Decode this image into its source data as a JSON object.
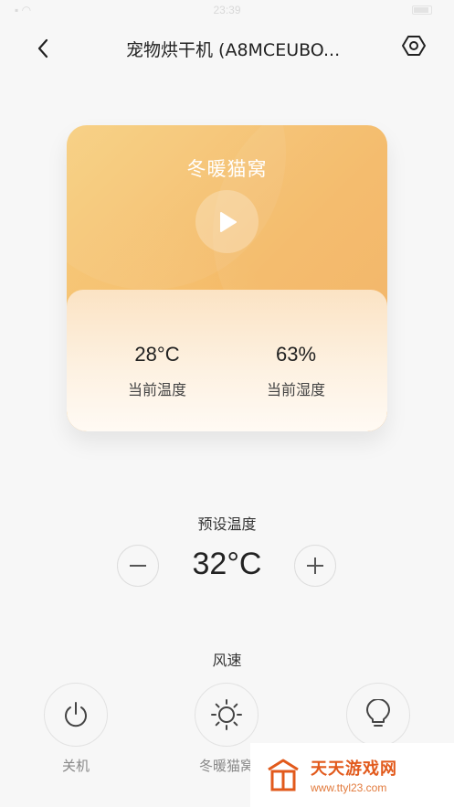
{
  "status_bar": {
    "time": "23:39"
  },
  "header": {
    "title": "宠物烘干机 (A8MCEUBO...",
    "back_icon": "chevron-left-icon",
    "settings_icon": "hexagon-gear-icon"
  },
  "card": {
    "mode_name": "冬暖猫窝",
    "play_icon": "play-icon",
    "current_temp": {
      "value": "28°C",
      "label": "当前温度"
    },
    "current_humidity": {
      "value": "63%",
      "label": "当前湿度"
    },
    "colors": {
      "gradient_start": "#f7cf80",
      "gradient_end": "#f2b060"
    }
  },
  "preset": {
    "label": "预设温度",
    "value": "32°C",
    "minus_icon": "minus-icon",
    "plus_icon": "plus-icon"
  },
  "fan_speed": {
    "label": "风速",
    "modes": [
      {
        "label": "关机",
        "icon": "power-icon"
      },
      {
        "label": "冬暖猫窝",
        "icon": "sun-icon"
      },
      {
        "label": "",
        "icon": "lightbulb-icon"
      }
    ]
  },
  "watermark": {
    "name": "天天游戏网",
    "url": "www.ttyl23.com"
  }
}
